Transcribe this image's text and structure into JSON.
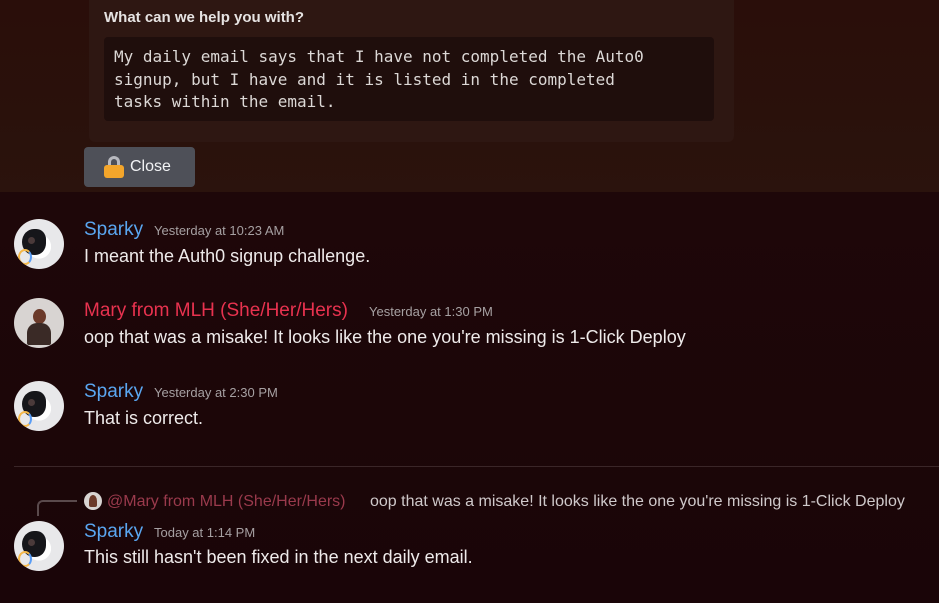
{
  "ticket": {
    "question": "What can we help you with?",
    "answer": "My daily email says that I have not completed the Auto0\nsignup, but I have and it is listed in the completed\ntasks within the email.",
    "close_label": "Close"
  },
  "messages": [
    {
      "author": "Sparky",
      "timestamp": "Yesterday at 10:23 AM",
      "text": "I meant the Auth0 signup challenge."
    },
    {
      "author": "Mary from MLH (She/Her/Hers)",
      "timestamp": "Yesterday at 1:30 PM",
      "text": "oop that was a misake! It looks like the one you're missing is 1-Click Deploy"
    },
    {
      "author": "Sparky",
      "timestamp": "Yesterday at 2:30 PM",
      "text": "That is correct."
    },
    {
      "reply": {
        "mention": "@Mary from MLH (She/Her/Hers)",
        "text": "oop that was a misake! It looks like the one you're missing is 1-Click Deploy"
      },
      "author": "Sparky",
      "timestamp": "Today at 1:14 PM",
      "text": "This still hasn't been fixed in the next daily email."
    }
  ]
}
